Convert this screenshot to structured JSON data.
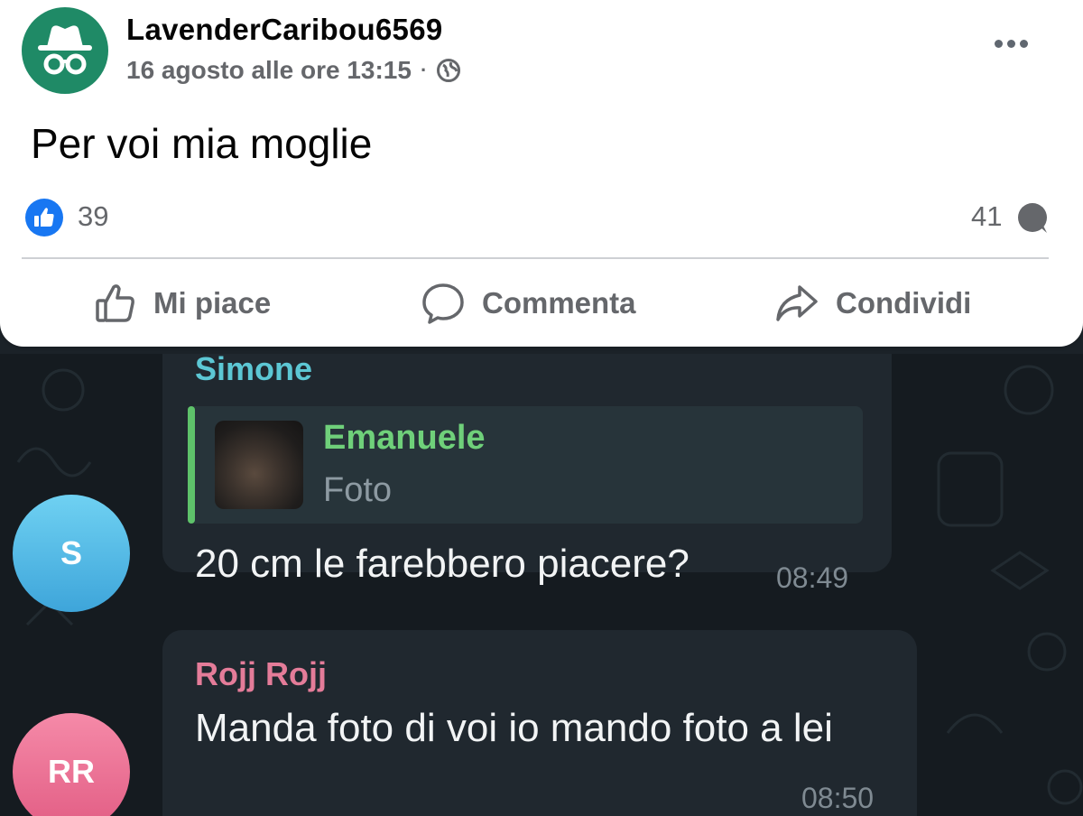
{
  "post": {
    "author": "LavenderCaribou6569",
    "timestamp": "16 agosto alle ore 13:15",
    "separator": "·",
    "text": "Per voi mia moglie",
    "like_count": "39",
    "comment_count": "41",
    "actions": {
      "like": "Mi piace",
      "comment": "Commenta",
      "share": "Condividi"
    },
    "icons": {
      "avatar": "incognito-icon",
      "privacy": "globe-icon",
      "menu": "more-dots-icon",
      "reaction": "thumbs-up-icon",
      "comments": "comment-bubble-icon"
    },
    "colors": {
      "avatar": "#1f8a66",
      "like_badge": "#1877f2",
      "meta_text": "#65676b"
    }
  },
  "chat": {
    "messages": [
      {
        "sender": "Simone",
        "avatar_initial": "S",
        "reply": {
          "name": "Emanuele",
          "type": "Foto"
        },
        "text": "20 cm le farebbero piacere?",
        "time": "08:49"
      },
      {
        "sender": "Rojj Rojj",
        "avatar_initial": "RR",
        "text": "Manda foto di voi io mando foto a lei",
        "time": "08:50"
      }
    ],
    "colors": {
      "simone_name": "#5cc7d4",
      "rojj_name": "#e47c99",
      "reply_name": "#6fd07a",
      "bubble": "#20282f"
    }
  }
}
